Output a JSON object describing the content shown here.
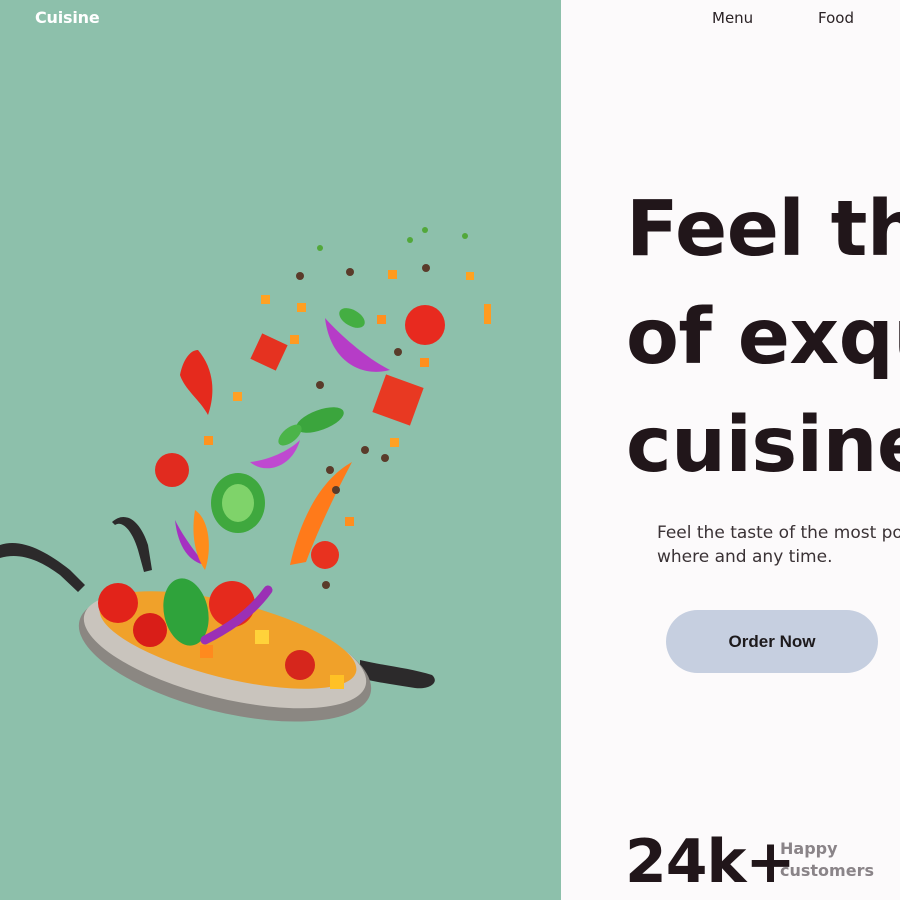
{
  "brand": {
    "name": "Cuisine"
  },
  "nav": {
    "items": [
      {
        "label": "Menu"
      },
      {
        "label": "Food"
      }
    ]
  },
  "hero": {
    "title_lines": [
      "Feel the",
      "of exqu",
      "cuisine"
    ],
    "subtitle_lines": [
      "Feel the taste of the most pop",
      "where and any time."
    ],
    "cta_label": "Order Now"
  },
  "stats": {
    "value": "24k+",
    "label_lines": [
      "Happy",
      "customers"
    ]
  },
  "colors": {
    "left_background": "#8dc0ab",
    "right_background": "#fcfafb",
    "button": "#c6cfe0",
    "heading": "#21161a"
  },
  "image": {
    "subject": "frying-pan-with-flying-vegetables"
  }
}
